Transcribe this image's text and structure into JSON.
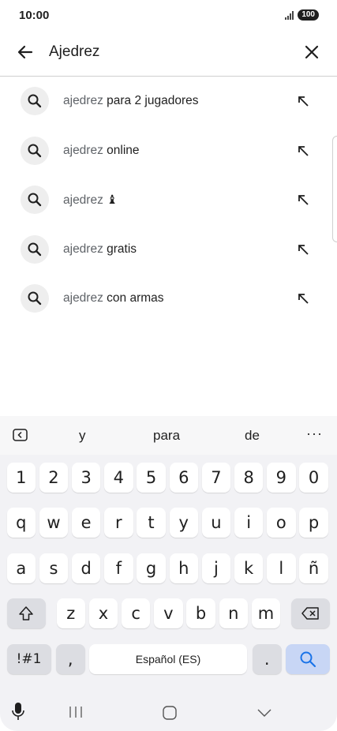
{
  "status": {
    "time": "10:00",
    "battery": "100"
  },
  "search": {
    "query": "Ajedrez"
  },
  "suggestions": [
    {
      "prefix": "ajedrez",
      "rest": " para 2 jugadores"
    },
    {
      "prefix": "ajedrez",
      "rest": " online"
    },
    {
      "prefix": "ajedrez",
      "rest": " ♝"
    },
    {
      "prefix": "ajedrez",
      "rest": " gratis"
    },
    {
      "prefix": "ajedrez",
      "rest": " con armas"
    }
  ],
  "keyboard": {
    "predictions": [
      "y",
      "para",
      "de"
    ],
    "more": "···",
    "row_numbers": [
      "1",
      "2",
      "3",
      "4",
      "5",
      "6",
      "7",
      "8",
      "9",
      "0"
    ],
    "row1": [
      "q",
      "w",
      "e",
      "r",
      "t",
      "y",
      "u",
      "i",
      "o",
      "p"
    ],
    "row2": [
      "a",
      "s",
      "d",
      "f",
      "g",
      "h",
      "j",
      "k",
      "l",
      "ñ"
    ],
    "row3": [
      "z",
      "x",
      "c",
      "v",
      "b",
      "n",
      "m"
    ],
    "symbols_label": "!#1",
    "comma": ",",
    "space_label": "Español (ES)",
    "period": "."
  },
  "colors": {
    "accent": "#1a73e8",
    "search_key": "#c8d6f5"
  }
}
